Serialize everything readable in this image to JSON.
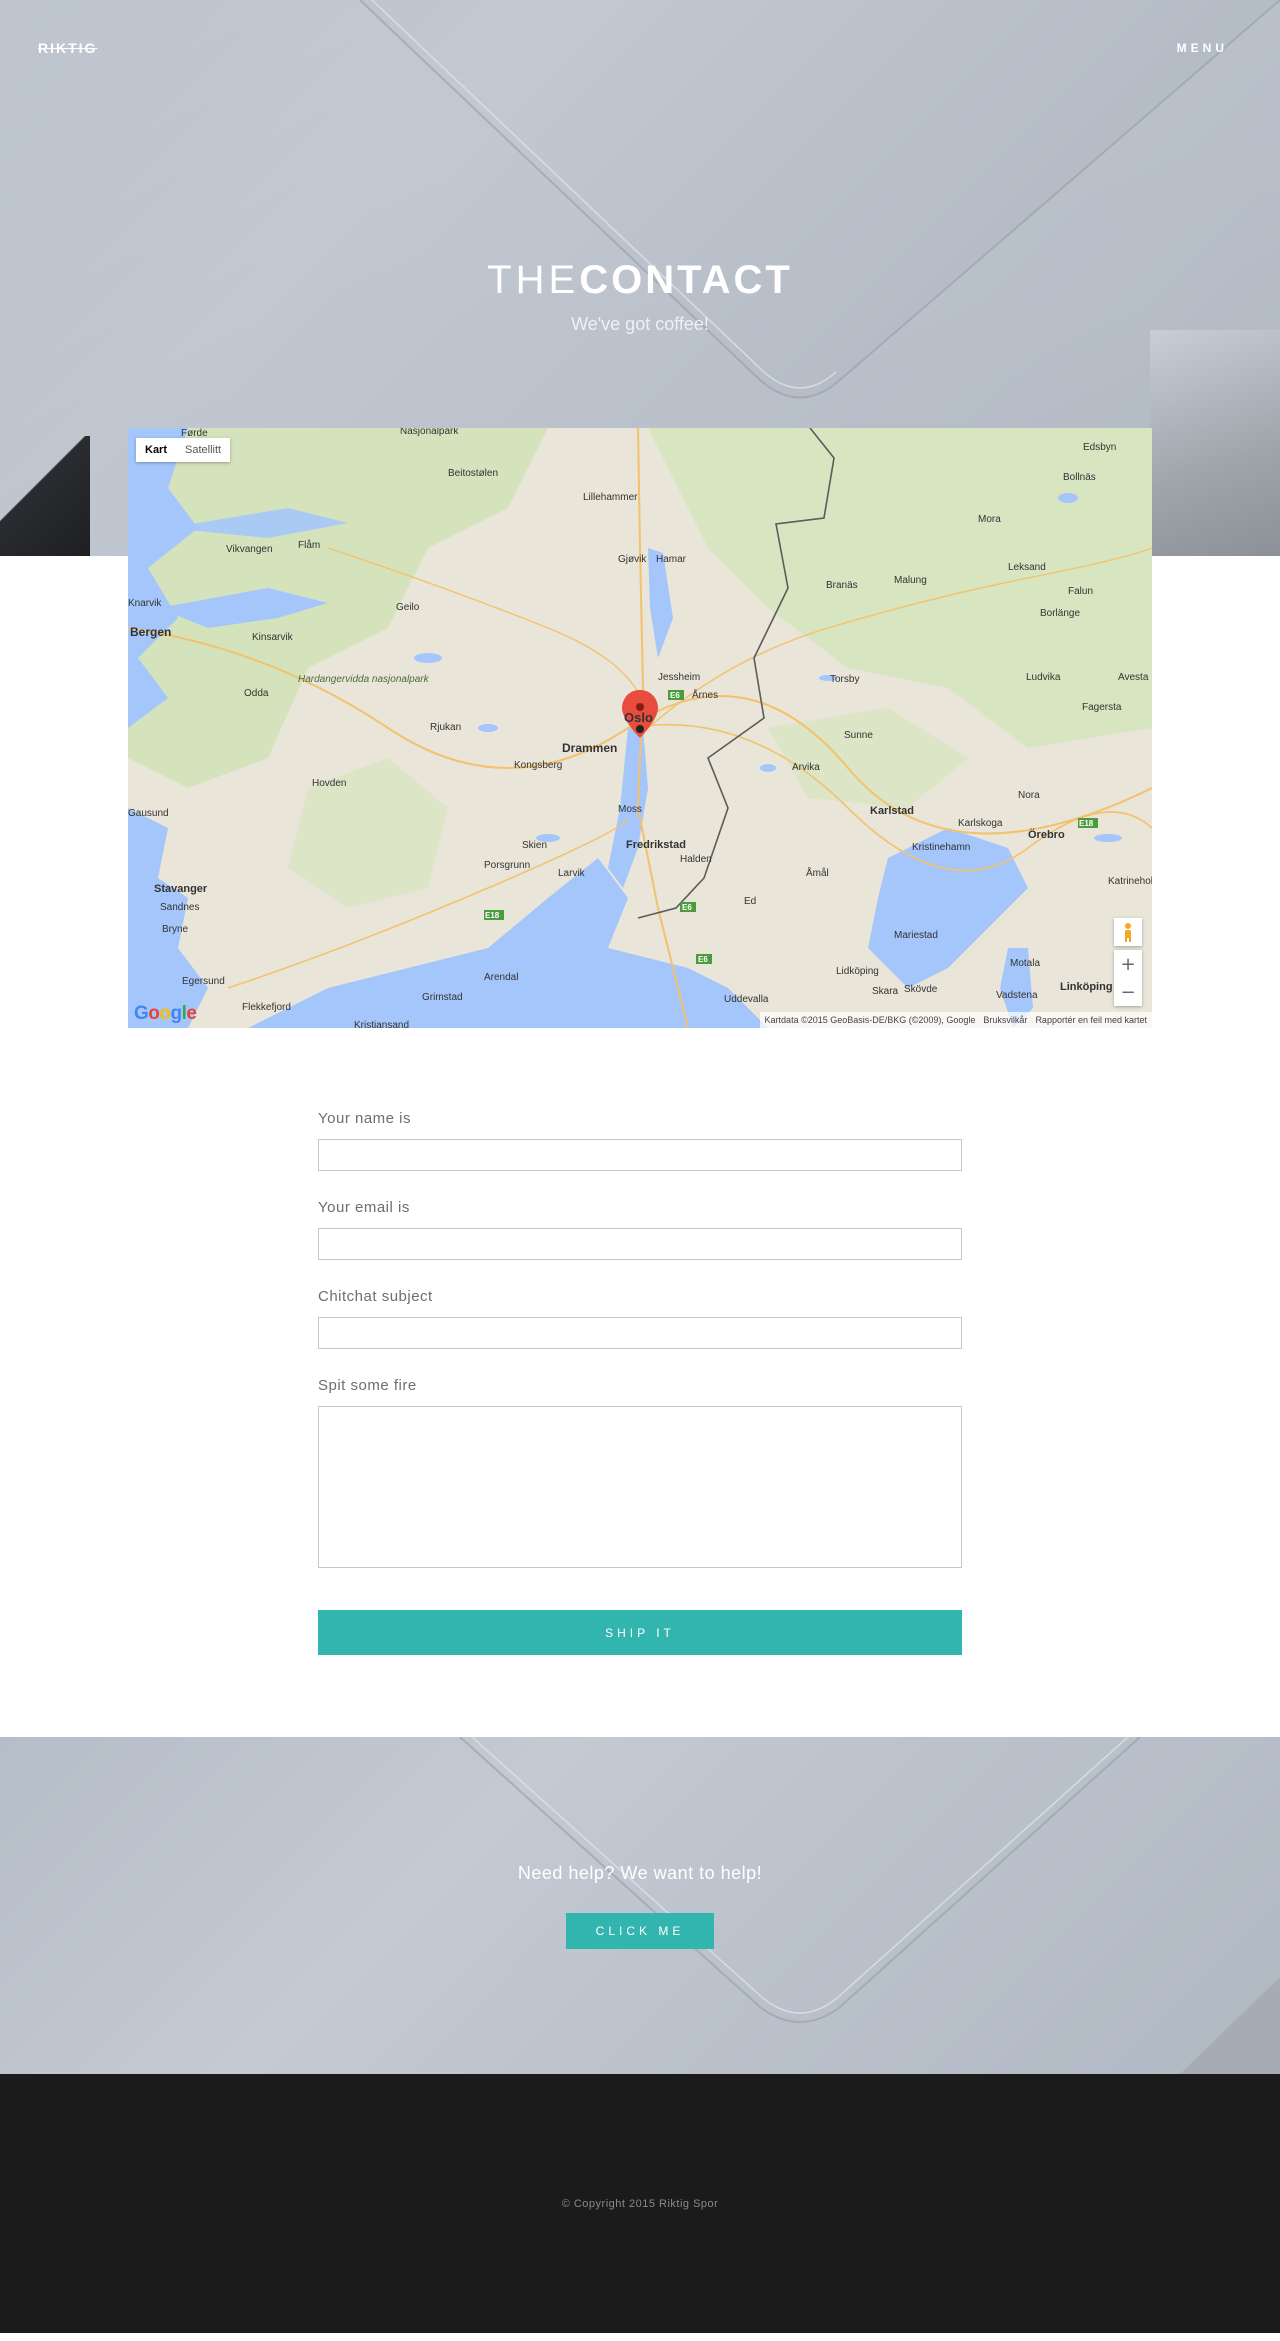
{
  "header": {
    "logo": "RIKTIG",
    "menu_label": "MENU"
  },
  "hero": {
    "title_light": "THE",
    "title_bold": "CONTACT",
    "subtitle": "We've got coffee!"
  },
  "map": {
    "type_tabs": [
      "Kart",
      "Satellitt"
    ],
    "active_tab": "Kart",
    "zoom_in": "+",
    "zoom_out": "−",
    "attribution": "Kartdata ©2015 GeoBasis-DE/BKG (©2009), Google",
    "terms": "Bruksvilkår",
    "report": "Rapportér en feil med kartet",
    "google_logo": "Google",
    "places": [
      "Førde",
      "Nasjonalpark",
      "Beitostølen",
      "Lillehammer",
      "Gjøvik",
      "Hamar",
      "Edsbyn",
      "Bollnäs",
      "Mora",
      "Vikvangen",
      "Flåm",
      "Branäs",
      "Malung",
      "Leksand",
      "Falun",
      "Borlänge",
      "Geilo",
      "Knarvik",
      "Bergen",
      "Kinsarvik",
      "Hardangervidda nasjonalpark",
      "Odda",
      "Jessheim",
      "Årnes",
      "Torsby",
      "Ludvika",
      "Avesta",
      "Fagersta",
      "Rjukan",
      "Oslo",
      "Sunne",
      "Drammen",
      "Kongsberg",
      "Arvika",
      "Hovden",
      "Nora",
      "Karlstad",
      "Karlskoga",
      "Örebro",
      "Moss",
      "Kristinehamn",
      "Skien",
      "Fredrikstad",
      "Halden",
      "Porsgrunn",
      "Larvik",
      "Åmål",
      "Katrineholm",
      "Stavanger",
      "Sandnes",
      "Bryne",
      "Mariestad",
      "Ed",
      "Arendal",
      "Motala",
      "Lidköping",
      "Egersund",
      "Grimstad",
      "Skara",
      "Skövde",
      "Vadstena",
      "Linköping",
      "Uddevalla",
      "Flekkefjord",
      "Kristiansand",
      "Gausund"
    ],
    "road_labels": [
      "E6",
      "E18",
      "E6",
      "E6",
      "E18"
    ],
    "colors": {
      "land": "#e8e4d8",
      "water": "#a3c6ff",
      "forest": "#cde3b1",
      "roads": "#f4c572"
    }
  },
  "form": {
    "name_label": "Your name is",
    "email_label": "Your email is",
    "subject_label": "Chitchat subject",
    "message_label": "Spit some fire",
    "name_value": "",
    "email_value": "",
    "subject_value": "",
    "message_value": "",
    "submit_label": "SHIP IT"
  },
  "help": {
    "text": "Need help? We want to help!",
    "button_label": "CLICK ME"
  },
  "footer": {
    "copyright": "© Copyright 2015 Riktig Spor"
  },
  "colors": {
    "accent": "#33b5af",
    "footer_bg": "#1b1b1b",
    "marker": "#e74c3c"
  }
}
